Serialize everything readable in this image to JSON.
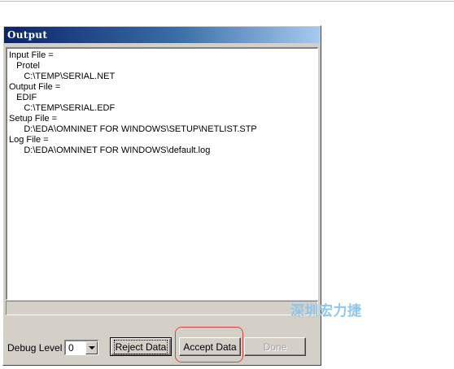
{
  "window": {
    "title": "Output"
  },
  "output": {
    "lines": [
      "Input File =",
      "   Protel",
      "      C:\\TEMP\\SERIAL.NET",
      "Output File =",
      "   EDIF",
      "      C:\\TEMP\\SERIAL.EDF",
      "Setup File =",
      "      D:\\EDA\\OMNINET FOR WINDOWS\\SETUP\\NETLIST.STP",
      "Log File =",
      "      D:\\EDA\\OMNINET FOR WINDOWS\\default.log"
    ]
  },
  "debug": {
    "label": "Debug Level :",
    "value": "0"
  },
  "buttons": {
    "reject": "Reject Data",
    "accept": "Accept Data",
    "done": "Done"
  },
  "watermark": "深圳宏力捷",
  "colors": {
    "title_bar_start": "#0a246a",
    "title_bar_end": "#a6caf0",
    "face": "#d4d0c8",
    "highlight_ring": "#e04040",
    "watermark": "#8fc6ee"
  }
}
